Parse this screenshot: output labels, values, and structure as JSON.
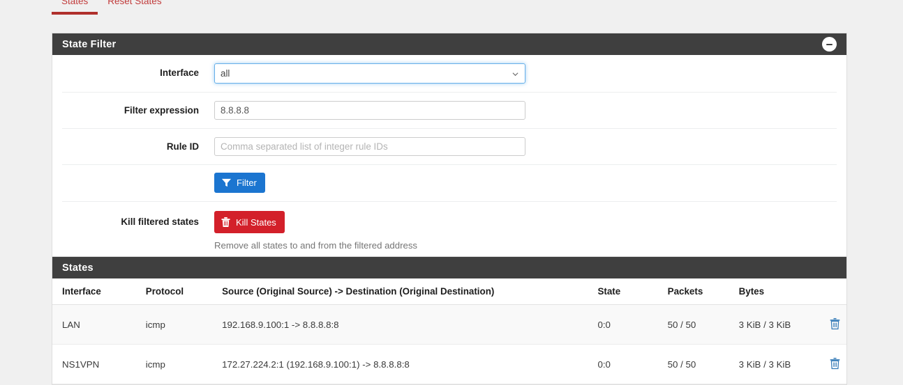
{
  "tabs": [
    {
      "label": "States",
      "active": true
    },
    {
      "label": "Reset States",
      "active": false
    }
  ],
  "state_filter": {
    "title": "State Filter",
    "collapse_icon": "minus-circle-icon",
    "interface": {
      "label": "Interface",
      "value": "all",
      "options": [
        "all"
      ],
      "chevron_icon": "chevron-down-icon"
    },
    "filter_expression": {
      "label": "Filter expression",
      "value": "8.8.8.8",
      "placeholder": ""
    },
    "rule_id": {
      "label": "Rule ID",
      "value": "",
      "placeholder": "Comma separated list of integer rule IDs"
    },
    "filter_button": {
      "label": "Filter",
      "icon": "funnel-icon",
      "color": "#1b75d0"
    },
    "kill": {
      "label": "Kill filtered states",
      "button_label": "Kill States",
      "button_icon": "trash-icon",
      "button_color": "#d3202a",
      "help": "Remove all states to and from the filtered address"
    }
  },
  "states_panel": {
    "title": "States",
    "columns": [
      "Interface",
      "Protocol",
      "Source (Original Source) -> Destination (Original Destination)",
      "State",
      "Packets",
      "Bytes",
      ""
    ],
    "rows": [
      {
        "interface": "LAN",
        "protocol": "icmp",
        "source_destination": "192.168.9.100:1 -> 8.8.8.8:8",
        "state": "0:0",
        "packets": "50 / 50",
        "bytes": "3 KiB / 3 KiB",
        "action_icon": "trash-icon"
      },
      {
        "interface": "NS1VPN",
        "protocol": "icmp",
        "source_destination": "172.27.224.2:1 (192.168.9.100:1) -> 8.8.8.8:8",
        "state": "0:0",
        "packets": "50 / 50",
        "bytes": "3 KiB / 3 KiB",
        "action_icon": "trash-icon"
      }
    ]
  },
  "colors": {
    "panel_heading_bg": "#3f3f3f",
    "tab_active": "#b0302c",
    "primary": "#1b75d0",
    "danger": "#d3202a",
    "page_bg": "#f0f0f0",
    "trash_link": "#337ab7"
  }
}
